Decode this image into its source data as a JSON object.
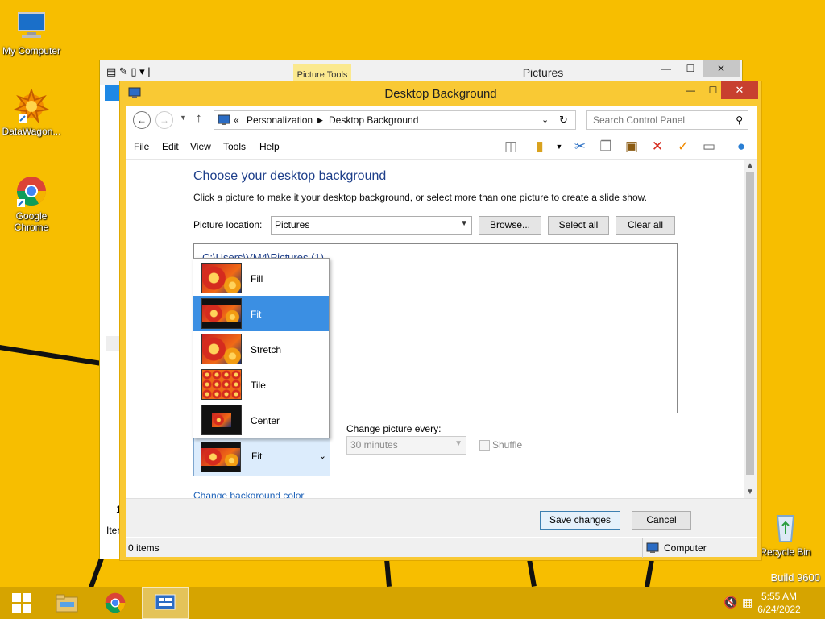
{
  "desktop": {
    "icons": [
      {
        "label": "My Computer"
      },
      {
        "label": "DataWagon..."
      },
      {
        "label": "Google Chrome"
      },
      {
        "label": "Recycle Bin"
      }
    ],
    "build_text": "Build 9600"
  },
  "back_window": {
    "title": "Pictures",
    "contextual_tab": "Picture Tools",
    "left_fragments": [
      "1",
      "Iter"
    ]
  },
  "window": {
    "title": "Desktop Background",
    "nav": {
      "breadcrumb_prefix": "«",
      "breadcrumbs": [
        "Personalization",
        "Desktop Background"
      ],
      "search_placeholder": "Search Control Panel"
    },
    "menu": [
      "File",
      "Edit",
      "View",
      "Tools",
      "Help"
    ],
    "content": {
      "heading": "Choose your desktop background",
      "description": "Click a picture to make it your desktop background, or select more than one picture to create a slide show.",
      "picture_location_label": "Picture location:",
      "picture_location_value": "Pictures",
      "browse_label": "Browse...",
      "select_all_label": "Select all",
      "clear_all_label": "Clear all",
      "group_label": "C:\\Users\\VM4\\Pictures (1)",
      "position_options": [
        "Fill",
        "Fit",
        "Stretch",
        "Tile",
        "Center"
      ],
      "position_selected": "Fit",
      "change_picture_label": "Change picture every:",
      "interval_value": "30 minutes",
      "shuffle_label": "Shuffle",
      "change_color_link": "Change background color"
    },
    "save_label": "Save changes",
    "cancel_label": "Cancel",
    "status": {
      "items": "0 items",
      "location": "Computer"
    }
  },
  "taskbar": {
    "time": "5:55 AM",
    "date": "6/24/2022"
  },
  "colors": {
    "desktop": "#f7be00",
    "window_frame": "#f9c934",
    "close_button": "#c8402f",
    "selection": "#3b8fe3",
    "heading": "#1e3f8a"
  }
}
